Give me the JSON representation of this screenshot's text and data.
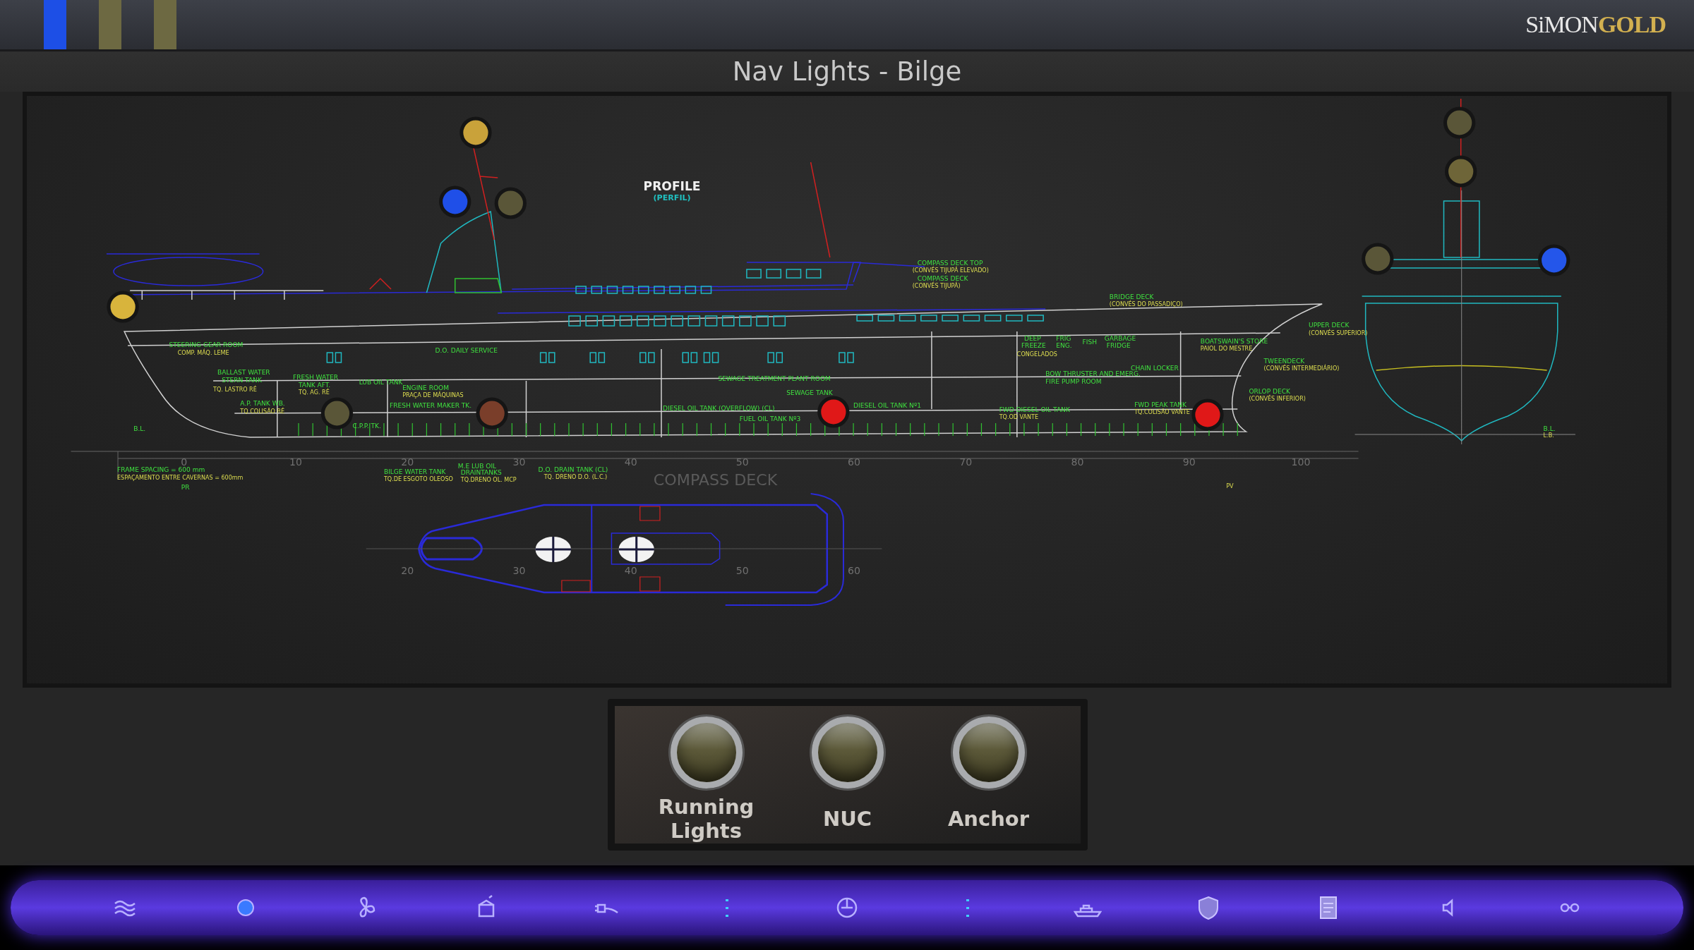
{
  "top_bar": {
    "indicators": [
      {
        "color": "#1d4fe6"
      },
      {
        "color": "#6d6942"
      },
      {
        "color": "#6d6942"
      }
    ],
    "logo": "SiMON**GOLD**"
  },
  "title": "Nav Lights - Bilge",
  "drawing": {
    "profile_title": "PROFILE",
    "profile_subtitle": "(PERFIL)",
    "compass_deck_title": "COMPASS DECK",
    "axis_ticks": [
      "0",
      "10",
      "20",
      "30",
      "40",
      "50",
      "60",
      "70",
      "80",
      "90",
      "100"
    ],
    "compass_deck_ticks": [
      "20",
      "30",
      "40",
      "50",
      "60"
    ],
    "labels": [
      {
        "text": "STEERING GEAR ROOM",
        "kind": "main"
      },
      {
        "text": "COMP. MÁQ. LEME",
        "kind": "sub"
      },
      {
        "text": "BALLAST WATER",
        "kind": "main"
      },
      {
        "text": "STERN TANK",
        "kind": "main"
      },
      {
        "text": "TQ. LASTRO RÉ",
        "kind": "sub"
      },
      {
        "text": "FRESH WATER",
        "kind": "main"
      },
      {
        "text": "TANK AFT.",
        "kind": "main"
      },
      {
        "text": "TQ. AG. RÉ",
        "kind": "sub"
      },
      {
        "text": "LUB OIL TANK",
        "kind": "main"
      },
      {
        "text": "D.O. DAILY SERVICE",
        "kind": "main"
      },
      {
        "text": "ENGINE ROOM",
        "kind": "main"
      },
      {
        "text": "PRAÇA DE MÁQUINAS",
        "kind": "sub"
      },
      {
        "text": "A.P. TANK WB.",
        "kind": "main"
      },
      {
        "text": "TQ.COLISÃO RÉ",
        "kind": "sub"
      },
      {
        "text": "FRESH WATER MAKER TK.",
        "kind": "main"
      },
      {
        "text": "C.P.P. TK.",
        "kind": "main"
      },
      {
        "text": "SEWAGE TREATMENT PLANT ROOM",
        "kind": "main"
      },
      {
        "text": "SEWAGE TANK",
        "kind": "main"
      },
      {
        "text": "DIESEL OIL TANK (OVERFLOW) (CL)",
        "kind": "main"
      },
      {
        "text": "FUEL OIL TANK Nº3",
        "kind": "main"
      },
      {
        "text": "B.L.",
        "kind": "main"
      },
      {
        "text": "FRAME SPACING = 600 mm",
        "kind": "main"
      },
      {
        "text": "ESPAÇAMENTO ENTRE CAVERNAS = 600mm",
        "kind": "sub"
      },
      {
        "text": "PR",
        "kind": "main"
      },
      {
        "text": "BILGE WATER TANK",
        "kind": "main"
      },
      {
        "text": "TQ.DE ESGOTO OLEOSO",
        "kind": "sub"
      },
      {
        "text": "M.E LUB OIL",
        "kind": "main"
      },
      {
        "text": "DRAINTANKS",
        "kind": "main"
      },
      {
        "text": "TQ.DRENO OL. MCP",
        "kind": "sub"
      },
      {
        "text": "D.O. DRAIN TANK (CL)",
        "kind": "main"
      },
      {
        "text": "TQ. DRENO D.O. (L.C.)",
        "kind": "sub"
      },
      {
        "text": "COMPASS DECK TOP",
        "kind": "main"
      },
      {
        "text": "(CONVÉS TIJUPÁ ELEVADO)",
        "kind": "sub"
      },
      {
        "text": "COMPASS DECK",
        "kind": "main"
      },
      {
        "text": "(CONVÉS TIJUPÁ)",
        "kind": "sub"
      },
      {
        "text": "BRIDGE DECK",
        "kind": "main"
      },
      {
        "text": "(CONVÉS DO PASSADIÇO)",
        "kind": "sub"
      },
      {
        "text": "UPPER DECK",
        "kind": "main"
      },
      {
        "text": "(CONVÉS SUPERIOR)",
        "kind": "sub"
      },
      {
        "text": "TWEENDECK",
        "kind": "main"
      },
      {
        "text": "(CONVÉS INTERMEDIÁRIO)",
        "kind": "sub"
      },
      {
        "text": "ORLOP DECK",
        "kind": "main"
      },
      {
        "text": "(CONVÉS INFERIOR)",
        "kind": "sub"
      },
      {
        "text": "DEEP",
        "kind": "main"
      },
      {
        "text": "FREEZE",
        "kind": "main"
      },
      {
        "text": "CONGELADOS",
        "kind": "sub"
      },
      {
        "text": "FRIG",
        "kind": "main"
      },
      {
        "text": "ENG.",
        "kind": "main"
      },
      {
        "text": "FISH",
        "kind": "main"
      },
      {
        "text": "GARBAGE",
        "kind": "main"
      },
      {
        "text": "FRIDGE",
        "kind": "main"
      },
      {
        "text": "BOATSWAIN'S STORE",
        "kind": "main"
      },
      {
        "text": "PAIOL DO MESTRE",
        "kind": "sub"
      },
      {
        "text": "CHAIN LOCKER",
        "kind": "main"
      },
      {
        "text": "BOW THRUSTER AND EMERG.",
        "kind": "main"
      },
      {
        "text": "FIRE PUMP ROOM",
        "kind": "main"
      },
      {
        "text": "DIESEL OIL TANK Nº1",
        "kind": "main"
      },
      {
        "text": "FWD DIESEL OIL TANK",
        "kind": "main"
      },
      {
        "text": "TQ.OD VANTE",
        "kind": "sub"
      },
      {
        "text": "FWD PEAK TANK",
        "kind": "main"
      },
      {
        "text": "TQ.COLISÃO VANTE",
        "kind": "sub"
      },
      {
        "text": "B.L.",
        "kind": "main"
      },
      {
        "text": "L.B.",
        "kind": "sub"
      },
      {
        "text": "PV",
        "kind": "sub"
      }
    ],
    "lights": [
      {
        "color": "#c9a23a"
      },
      {
        "color": "#1f4fe8"
      },
      {
        "color": "#5a5638"
      },
      {
        "color": "#d8b43c"
      },
      {
        "color": "#5a5638"
      },
      {
        "color": "#7a3e2a"
      },
      {
        "color": "#e01818"
      },
      {
        "color": "#e01818"
      },
      {
        "color": "#5a5638"
      },
      {
        "color": "#6e6538"
      },
      {
        "color": "#5a5638"
      },
      {
        "color": "#2456ea"
      }
    ]
  },
  "controls": [
    {
      "label": "Running Lights",
      "on": false
    },
    {
      "label": "NUC",
      "on": false
    },
    {
      "label": "Anchor",
      "on": false
    }
  ]
}
